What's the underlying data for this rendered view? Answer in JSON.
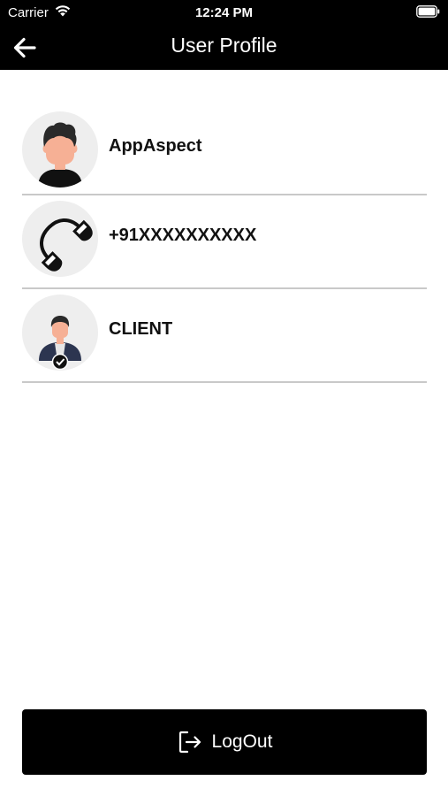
{
  "status_bar": {
    "carrier": "Carrier",
    "time": "12:24 PM",
    "icons": [
      "wifi-icon",
      "battery-icon"
    ]
  },
  "header": {
    "title": "User Profile",
    "back_icon": "arrow-left-icon"
  },
  "profile": {
    "rows": [
      {
        "icon": "user-avatar-icon",
        "text": "AppAspect"
      },
      {
        "icon": "phone-icon",
        "text": "+91XXXXXXXXXX"
      },
      {
        "icon": "client-role-icon",
        "text": "CLIENT"
      }
    ]
  },
  "actions": {
    "logout_label": "LogOut",
    "logout_icon": "logout-icon"
  },
  "colors": {
    "bar": "#000000",
    "divider": "#c9c9c9",
    "avatar_bg": "#eeeeee",
    "skin": "#f6b095"
  }
}
